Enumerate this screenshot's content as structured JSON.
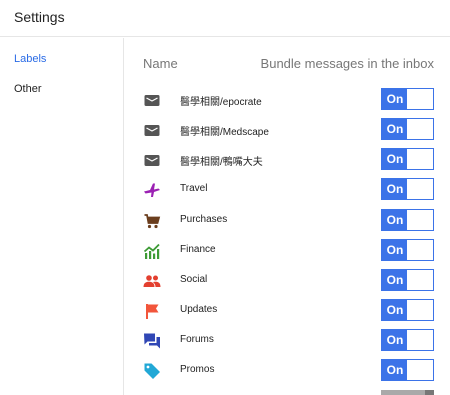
{
  "header": {
    "title": "Settings"
  },
  "sidebar": {
    "items": [
      {
        "label": "Labels"
      },
      {
        "label": "Other"
      }
    ]
  },
  "columns": {
    "name": "Name",
    "bundle": "Bundle messages in the inbox"
  },
  "rows": [
    {
      "label": "醫學相關/epocrate",
      "icon": "label-icon",
      "toggle": "On"
    },
    {
      "label": "醫學相關/Medscape",
      "icon": "label-icon",
      "toggle": "On"
    },
    {
      "label": "醫學相關/鴨嘴大夫",
      "icon": "label-icon",
      "toggle": "On"
    },
    {
      "label": "Travel",
      "icon": "airplane-icon",
      "toggle": "On"
    },
    {
      "label": "Purchases",
      "icon": "shopping-cart-icon",
      "toggle": "On"
    },
    {
      "label": "Finance",
      "icon": "chart-icon",
      "toggle": "On"
    },
    {
      "label": "Social",
      "icon": "people-icon",
      "toggle": "On"
    },
    {
      "label": "Updates",
      "icon": "flag-icon",
      "toggle": "On"
    },
    {
      "label": "Forums",
      "icon": "forum-icon",
      "toggle": "On"
    },
    {
      "label": "Promos",
      "icon": "tag-icon",
      "toggle": "On"
    }
  ],
  "colors": {
    "accent": "#3b73e8",
    "travel": "#9b21b3",
    "purchases": "#6b3e1e",
    "finance": "#3d9b35",
    "social": "#e33f2f",
    "updates": "#f2553b",
    "forums": "#3047b5",
    "promos": "#22a8d6"
  }
}
